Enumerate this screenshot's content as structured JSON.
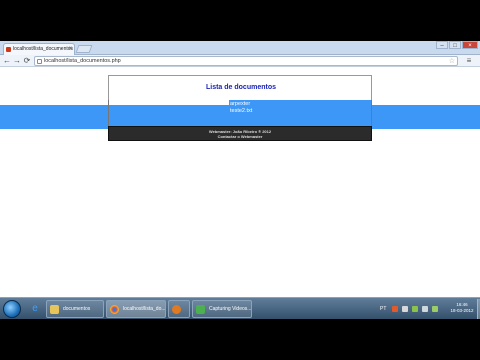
{
  "browser": {
    "tab_title": "localhost/lista_documentos",
    "tab_close": "×",
    "url": "localhost/lista_documentos.php",
    "minimize": "–",
    "maximize": "□",
    "close": "×",
    "back": "←",
    "forward": "→",
    "reload": "⟳",
    "star": "☆",
    "wrench": "≡"
  },
  "page": {
    "title": "Lista de documentos",
    "items": [
      "arpexter",
      "teste2.txt"
    ],
    "footer_line1": "Webmaster: João Ribeiro ® 2012",
    "footer_line2": "Contactar o Webmaster"
  },
  "taskbar": {
    "buttons": [
      {
        "label": "documentos"
      },
      {
        "label": "localhost/lista_do..."
      },
      {
        "label": ""
      },
      {
        "label": "Capturing Videos..."
      }
    ],
    "tray_lang": "PT",
    "clock_time": "16:46",
    "clock_date": "18-03-2012"
  },
  "colors": {
    "accent_blue": "#3d97f7",
    "title_blue": "#1a24b5",
    "footer_bg": "#2b2b2b"
  }
}
